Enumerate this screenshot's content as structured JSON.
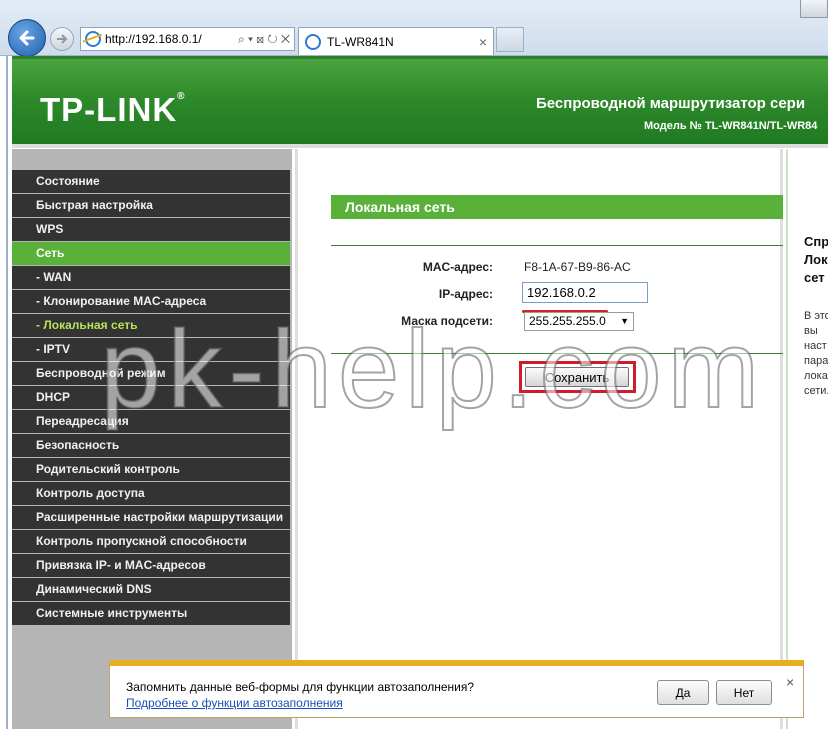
{
  "browser": {
    "url": "http://192.168.0.1/",
    "tab_title": "TL-WR841N",
    "tab_close": "×",
    "address_tools": "⌕ ▾ ⊠ ↻ ✕"
  },
  "header": {
    "logo": "TP-LINK",
    "logo_mark": "®",
    "title": "Беспроводной маршрутизатор сери",
    "model": "Модель № TL-WR841N/TL-WR84"
  },
  "sidebar": {
    "items": [
      {
        "label": "Состояние"
      },
      {
        "label": "Быстрая настройка"
      },
      {
        "label": "WPS"
      },
      {
        "label": "Сеть"
      },
      {
        "label": "- WAN"
      },
      {
        "label": "- Клонирование MAC-адреса"
      },
      {
        "label": "- Локальная сеть"
      },
      {
        "label": "- IPTV"
      },
      {
        "label": "Беспроводной режим"
      },
      {
        "label": "DHCP"
      },
      {
        "label": "Переадресация"
      },
      {
        "label": "Безопасность"
      },
      {
        "label": "Родительский контроль"
      },
      {
        "label": "Контроль доступа"
      },
      {
        "label": "Расширенные настройки маршрутизации"
      },
      {
        "label": "Контроль пропускной способности"
      },
      {
        "label": "Привязка IP- и MAC-адресов"
      },
      {
        "label": "Динамический DNS"
      },
      {
        "label": "Системные инструменты"
      }
    ]
  },
  "main": {
    "title": "Локальная сеть",
    "mac_label": "MAC-адрес:",
    "mac_value": "F8-1A-67-B9-86-AC",
    "ip_label": "IP-адрес:",
    "ip_value": "192.168.0.2",
    "mask_label": "Маска подсети:",
    "mask_value": "255.255.255.0",
    "save_label": "Сохранить"
  },
  "help": {
    "title": "Спр\nЛок\nсет",
    "body": "В это\nвы\nнаст\nпара\nлока\nсети.",
    "bullet": "•"
  },
  "watermark": "pk-help.com",
  "autocomplete": {
    "question": "Запомнить данные веб-формы для функции автозаполнения?",
    "link": "Подробнее о функции автозаполнения",
    "yes": "Да",
    "no": "Нет",
    "close": "×"
  },
  "colors": {
    "brand_green": "#5ab13a",
    "menu_dark": "#333333",
    "highlight_red": "#d11a2a",
    "notify_yellow": "#e9ad1d"
  }
}
